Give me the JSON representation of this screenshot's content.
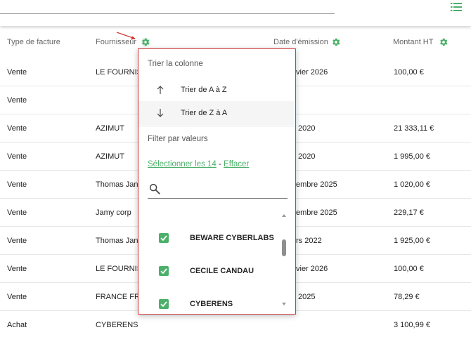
{
  "columns": {
    "type": "Type de facture",
    "supplier": "Fournisseur",
    "date": "Date d'émission",
    "amount": "Montant HT"
  },
  "colors": {
    "accent": "#4caf6a",
    "highlight_border": "#d23a3a"
  },
  "icons": {
    "list": "list-icon",
    "gear": "gear-icon",
    "search": "search-icon"
  },
  "rows": [
    {
      "type": "Vente",
      "supplier": "LE FOURNIS",
      "date": "vier 2026",
      "amount": "100,00 €"
    },
    {
      "type": "Vente",
      "supplier": "",
      "date": "",
      "amount": ""
    },
    {
      "type": "Vente",
      "supplier": "AZIMUT",
      "date": "2020",
      "amount": "21 333,11 €"
    },
    {
      "type": "Vente",
      "supplier": "AZIMUT",
      "date": "2020",
      "amount": "1 995,00 €"
    },
    {
      "type": "Vente",
      "supplier": "Thomas Jan",
      "date": "embre 2025",
      "amount": "1 020,00 €"
    },
    {
      "type": "Vente",
      "supplier": "Jamy corp",
      "date": "embre 2025",
      "amount": "229,17 €"
    },
    {
      "type": "Vente",
      "supplier": "Thomas Jan",
      "date": "rs 2022",
      "amount": "1 925,00 €"
    },
    {
      "type": "Vente",
      "supplier": "LE FOURNIS",
      "date": "vier 2026",
      "amount": "100,00 €"
    },
    {
      "type": "Vente",
      "supplier": "FRANCE FRA",
      "date": "2025",
      "amount": "78,29 €"
    },
    {
      "type": "Achat",
      "supplier": "CYBERENS",
      "date": "",
      "amount": "3 100,99 €"
    }
  ],
  "popup": {
    "sort_title": "Trier la colonne",
    "sort_asc": "Trier de A à Z",
    "sort_desc": "Trier de Z à A",
    "filter_title": "Filter par valeurs",
    "select_all": "Sélectionner les 14",
    "separator": " - ",
    "clear": "Effacer",
    "search_placeholder": "",
    "values": [
      {
        "label": "BEWARE CYBERLABS",
        "checked": true
      },
      {
        "label": "CECILE CANDAU",
        "checked": true
      },
      {
        "label": "CYBERENS",
        "checked": true
      }
    ]
  }
}
